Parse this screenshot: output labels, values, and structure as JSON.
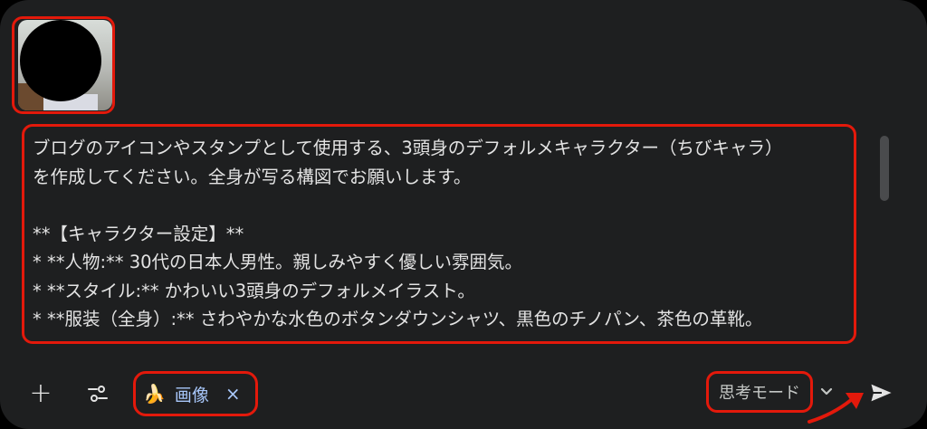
{
  "attachment": {
    "name": "attached-photo"
  },
  "prompt": {
    "lines": [
      "ブログのアイコンやスタンプとして使用する、3頭身のデフォルメキャラクター（ちびキャラ）",
      "を作成してください。全身が写る構図でお願いします。",
      "",
      "**【キャラクター設定】**",
      "* **人物:** 30代の日本人男性。親しみやすく優しい雰囲気。",
      "* **スタイル:** かわいい3頭身のデフォルメイラスト。",
      "* **服装（全身）:** さわやかな水色のボタンダウンシャツ、黒色のチノパン、茶色の革靴。"
    ]
  },
  "toolbar": {
    "add_icon": "plus-icon",
    "tools_icon": "tune-icon",
    "chip": {
      "icon": "🍌",
      "label": "画像",
      "close": "×"
    },
    "mode_label": "思考モード",
    "send_icon": "send-icon"
  },
  "colors": {
    "background": "#1e1f20",
    "text": "#e3e3e3",
    "chip_text": "#a8c7fa",
    "highlight": "#e3190b"
  }
}
